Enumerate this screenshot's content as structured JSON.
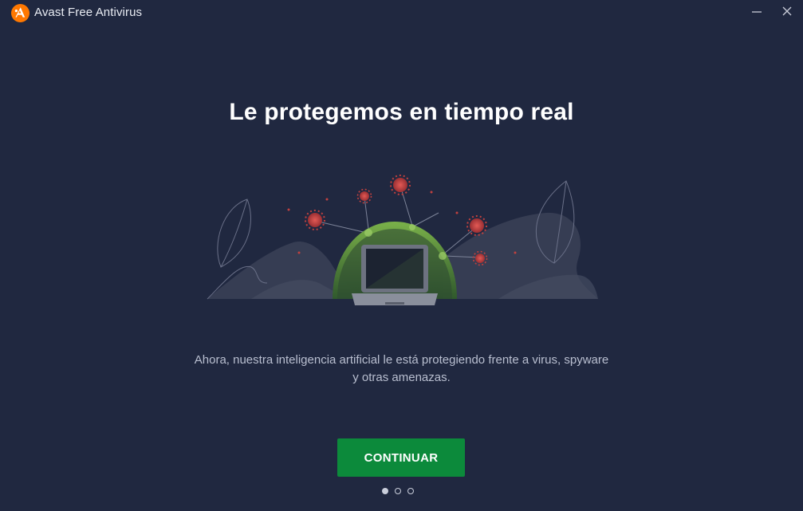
{
  "window": {
    "title": "Avast Free Antivirus",
    "logo_icon": "avast-logo-icon",
    "controls": [
      "minimize-icon",
      "close-icon"
    ]
  },
  "onboarding": {
    "headline": "Le protegemos en tiempo real",
    "illustration_icon": "laptop-shield-virus-illustration",
    "description": "Ahora, nuestra inteligencia artificial le está protegiendo frente a virus, spyware y otras amenazas.",
    "continue_label": "CONTINUAR",
    "pager": {
      "total": 3,
      "current": 1
    }
  },
  "colors": {
    "background": "#202840",
    "accent": "#0c8a3b",
    "brand": "#ff7800",
    "shield": "#6aa33a",
    "virus": "#c0413f"
  }
}
